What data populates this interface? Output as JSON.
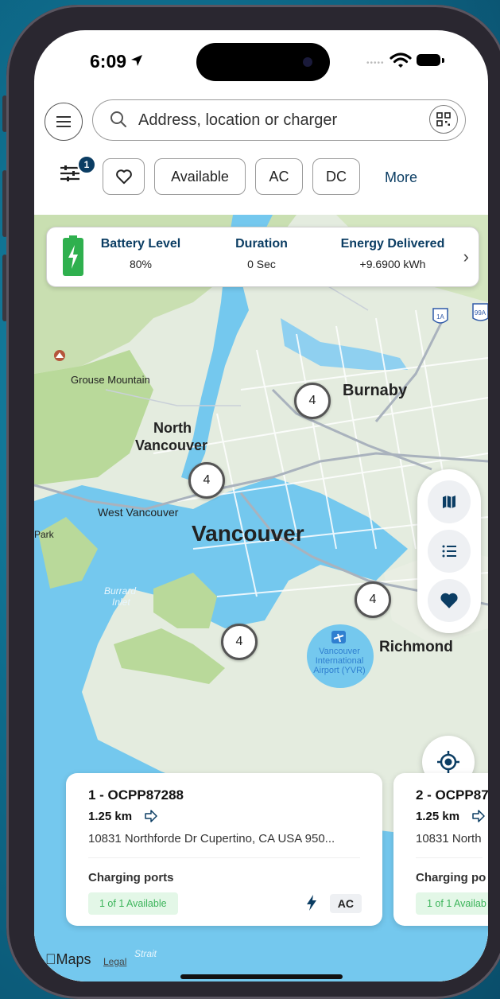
{
  "status_bar": {
    "time": "6:09"
  },
  "search": {
    "placeholder": "Address, location or charger"
  },
  "filters": {
    "badge_count": "1",
    "chips": [
      "Available",
      "AC",
      "DC"
    ],
    "more_label": "More"
  },
  "charging_session": {
    "battery_level_label": "Battery Level",
    "battery_level_value": "80%",
    "duration_label": "Duration",
    "duration_value": "0 Sec",
    "energy_label": "Energy Delivered",
    "energy_value": "+9.6900 kWh"
  },
  "map": {
    "labels": {
      "grouse": "Grouse Mountain",
      "burnaby": "Burnaby",
      "north_vancouver_1": "North",
      "north_vancouver_2": "Vancouver",
      "west_vancouver": "West Vancouver",
      "vancouver": "Vancouver",
      "park": "Park",
      "burrard_1": "Burrard",
      "burrard_2": "Inlet",
      "richmond": "Richmond",
      "airport_1": "Vancouver",
      "airport_2": "International",
      "airport_3": "Airport (YVR)",
      "strait": "Strait",
      "hwy_1a": "1A",
      "hwy_99a": "99A"
    },
    "clusters": [
      "4",
      "4",
      "4",
      "4"
    ],
    "attribution": {
      "maps": "Maps",
      "legal": "Legal"
    }
  },
  "stations": [
    {
      "title": "1 - OCPP87288",
      "distance": "1.25 km",
      "address": "10831 Northforde Dr Cupertino, CA USA 950...",
      "ports_label": "Charging ports",
      "availability": "1 of 1 Available",
      "type": "AC"
    },
    {
      "title": "2 - OCPP87",
      "distance": "1.25 km",
      "address": "10831 North",
      "ports_label": "Charging po",
      "availability": "1 of 1 Availab"
    }
  ],
  "colors": {
    "brand_navy": "#0b3d63",
    "available_green": "#3cb45a",
    "battery_green": "#2fb04e",
    "water": "#6fc7ef",
    "land": "#e4ecdf",
    "park": "#b9d99a"
  }
}
